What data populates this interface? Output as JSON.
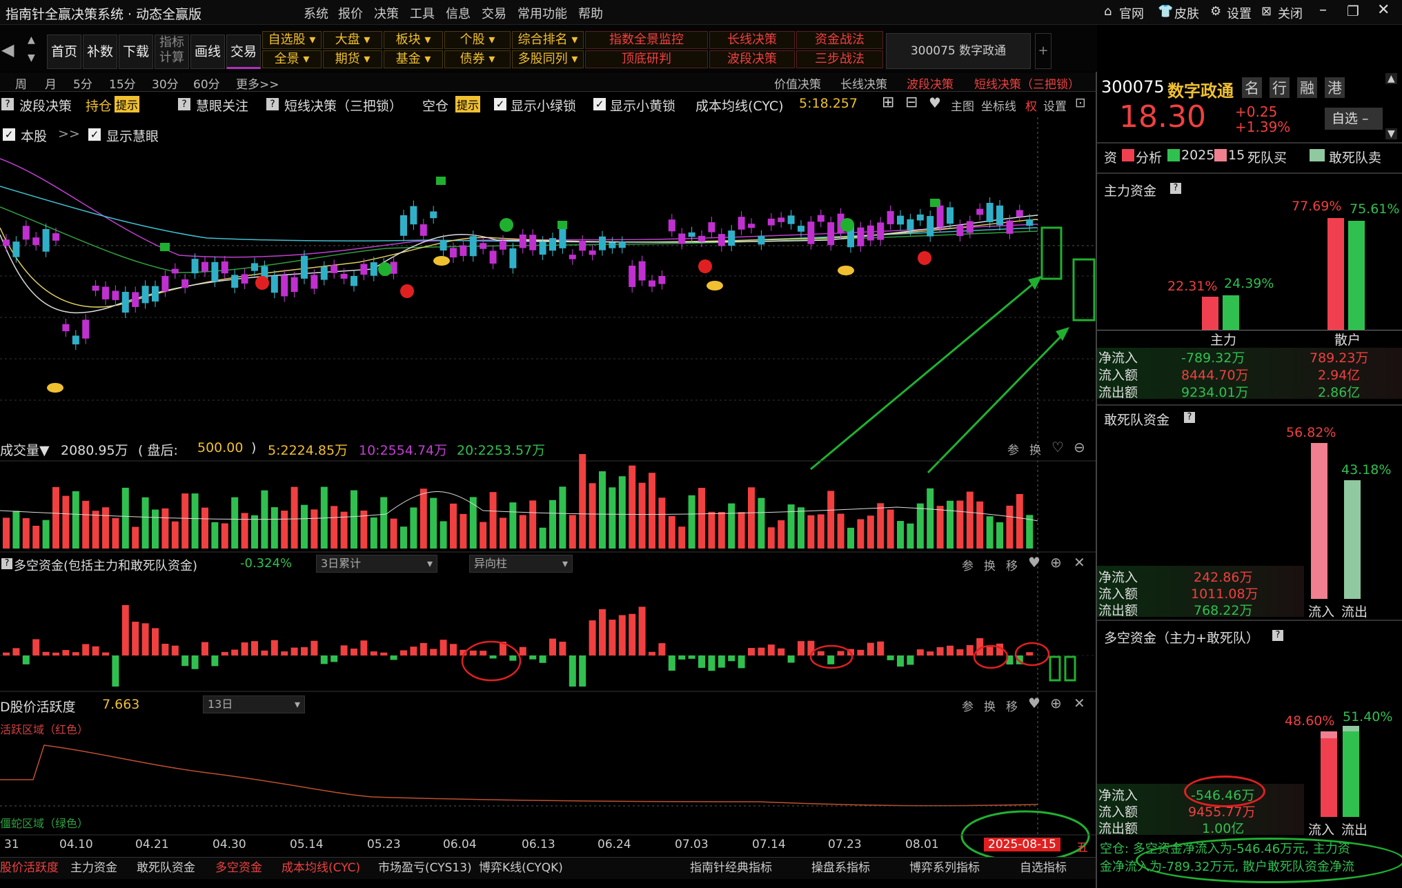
{
  "app": {
    "title": "指南针全赢决策系统 · 动态全赢版",
    "menu": [
      "系统",
      "报价",
      "决策",
      "工具",
      "信息",
      "交易",
      "常用功能",
      "帮助"
    ],
    "top_right": [
      "官网",
      "皮肤",
      "设置",
      "关闭"
    ]
  },
  "toolbar": {
    "nav": [
      "首页",
      "补数",
      "下载",
      "指标\n计算",
      "画线",
      "交易"
    ],
    "grid_row1": [
      "自选股",
      "大盘",
      "板块",
      "个股",
      "综合排名"
    ],
    "grid_row2": [
      "全景",
      "期货",
      "基金",
      "债券",
      "多股同列"
    ],
    "red_row1": [
      "指数全景监控",
      "长线决策",
      "资金战法"
    ],
    "red_row2": [
      "顶底研判",
      "波段决策",
      "三步战法"
    ],
    "stock_tab": "300075  数字政通"
  },
  "period_bar": {
    "periods": [
      "周",
      "月",
      "5分",
      "15分",
      "30分",
      "60分",
      "更多>>"
    ],
    "decision_tabs": [
      "价值决策",
      "长线决策",
      "波段决策",
      "短线决策（三把锁）"
    ]
  },
  "indicator_bar": {
    "item1": "波段决策",
    "hold": "持仓",
    "hint1": "提示",
    "item2": "慧眼关注",
    "item3": "短线决策（三把锁）",
    "empty": "空仓",
    "hint2": "提示",
    "item4": "显示小绿锁",
    "item5": "显示小黄锁",
    "cyc": "成本均线(CYC)",
    "cyc_val": "5:18.257",
    "right": [
      "主图",
      "坐标线",
      "权",
      "设置"
    ],
    "row2": [
      "本股",
      ">>",
      "显示慧眼"
    ]
  },
  "volume": {
    "label": "成交量▼",
    "value": "2080.95万",
    "after_label": "( 盘后:",
    "after_value": "500.00",
    "after_close": ")",
    "ma5": "5:2224.85万",
    "ma10": "10:2554.74万",
    "ma20": "20:2253.57万",
    "tools": [
      "参",
      "换"
    ]
  },
  "duokong": {
    "label": "多空资金(包括主力和敢死队资金)",
    "value": "-0.324%",
    "select1": "3日累计",
    "select2": "异向柱",
    "tools": [
      "参",
      "换",
      "移"
    ]
  },
  "active": {
    "label": "D股价活跃度",
    "value": "7.663",
    "select": "13日",
    "tools": [
      "参",
      "换",
      "移"
    ],
    "red_zone": "活跃区域（红色）",
    "green_zone": "僵蛇区域（绿色）"
  },
  "dates": [
    "31",
    "04.10",
    "04.21",
    "04.30",
    "05.14",
    "05.23",
    "06.04",
    "06.13",
    "06.24",
    "07.03",
    "07.14",
    "07.23",
    "08.01"
  ],
  "current_date": "2025-08-15",
  "current_date_suffix": "五",
  "bottom_tabs": [
    "股价活跃度",
    "主力资金",
    "敢死队资金",
    "多空资金",
    "成本均线(CYC)",
    "市场盈亏(CYS13)",
    "博弈K线(CYQK)"
  ],
  "bottom_right_tabs": [
    "指南针经典指标",
    "操盘系指标",
    "博弈系列指标",
    "自选指标"
  ],
  "right": {
    "code": "300075",
    "name": "数字政通",
    "badges": [
      "名",
      "行",
      "融",
      "港"
    ],
    "price": "18.30",
    "change": "+0.25",
    "change_pct": "+1.39%",
    "watch_btn": "自选",
    "legend_prefix": "资",
    "legend_a": "分析",
    "legend_b": "2025",
    "legend_c": "15",
    "legend_d": "死队买",
    "legend_e": "敢死队卖",
    "main": {
      "title": "主力资金",
      "pct1": "22.31%",
      "pct2": "24.39%",
      "pct3": "77.69%",
      "pct4": "75.61%",
      "lbl1": "主力",
      "lbl2": "散户",
      "rows": [
        {
          "label": "净流入",
          "a": "-789.32万",
          "b": "789.23万"
        },
        {
          "label": "流入额",
          "a": "8444.70万",
          "b": "2.94亿"
        },
        {
          "label": "流出额",
          "a": "9234.01万",
          "b": "2.86亿"
        }
      ]
    },
    "dare": {
      "title": "敢死队资金",
      "pct1": "56.82%",
      "pct2": "43.18%",
      "rows": [
        {
          "label": "净流入",
          "a": "242.86万"
        },
        {
          "label": "流入额",
          "a": "1011.08万"
        },
        {
          "label": "流出额",
          "a": "768.22万"
        }
      ],
      "lbl_in": "流入",
      "lbl_out": "流出"
    },
    "dk": {
      "title": "多空资金（主力+敢死队）",
      "pct1": "48.60%",
      "pct2": "51.40%",
      "rows": [
        {
          "label": "净流入",
          "a": "-546.46万"
        },
        {
          "label": "流入额",
          "a": "9455.77万"
        },
        {
          "label": "流出额",
          "a": "1.00亿"
        }
      ],
      "lbl_in": "流入",
      "lbl_out": "流出"
    },
    "summary_line1": "空仓: 多空资金净流入为-546.46万元, 主力资",
    "summary_line2": "金净流入为-789.32万元, 散户敢死队资金净流"
  },
  "colors": {
    "up": "#f04040",
    "down": "#30c050",
    "gold": "#f0c030",
    "green_arrow": "#20b030"
  }
}
